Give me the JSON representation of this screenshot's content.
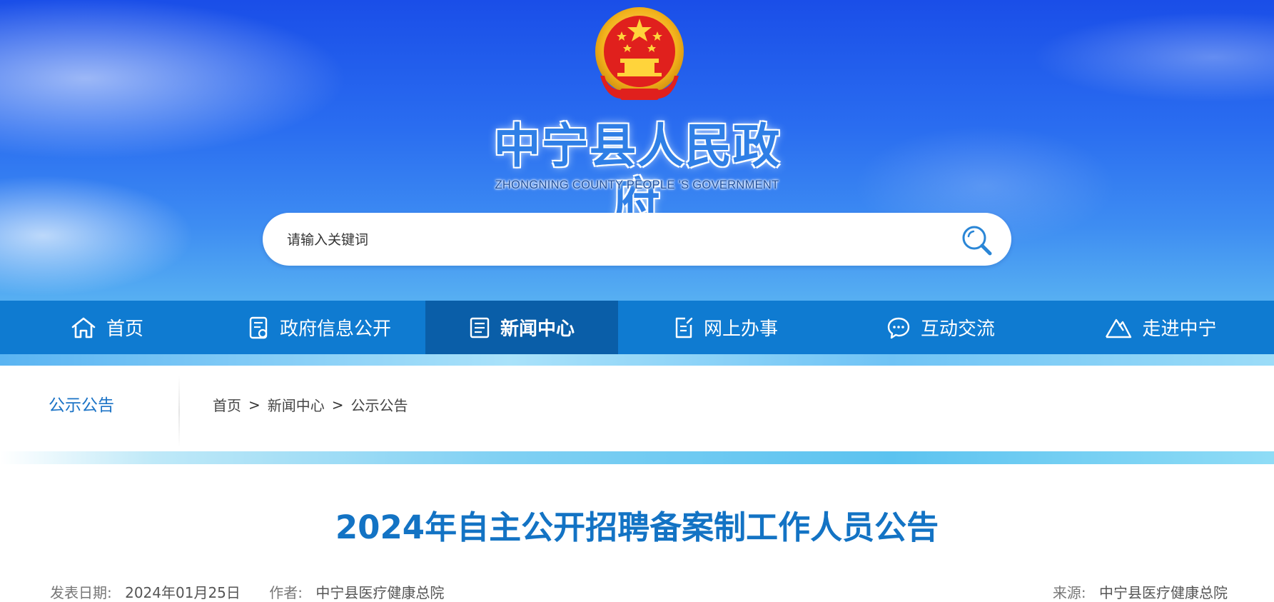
{
  "header": {
    "title": "中宁县人民政府",
    "subtitle": "ZHONGNING COUNTY PEOPLE 'S GOVERNMENT"
  },
  "search": {
    "placeholder": "请输入关键词"
  },
  "nav": {
    "items": [
      {
        "label": "首页",
        "icon": "home-icon"
      },
      {
        "label": "政府信息公开",
        "icon": "document-icon"
      },
      {
        "label": "新闻中心",
        "icon": "news-icon",
        "active": true
      },
      {
        "label": "网上办事",
        "icon": "form-icon"
      },
      {
        "label": "互动交流",
        "icon": "chat-icon"
      },
      {
        "label": "走进中宁",
        "icon": "mountain-icon"
      }
    ]
  },
  "breadcrumb": {
    "section": "公示公告",
    "items": [
      "首页",
      "新闻中心",
      "公示公告"
    ],
    "separator": ">"
  },
  "article": {
    "title": "2024年自主公开招聘备案制工作人员公告",
    "date_label": "发表日期:",
    "date": "2024年01月25日",
    "author_label": "作者:",
    "author": "中宁县医疗健康总院",
    "source_label": "来源:",
    "source": "中宁县医疗健康总院"
  },
  "colors": {
    "nav_bg": "#0f7bd1",
    "nav_active_bg": "#0a5ea8",
    "accent": "#1373c4"
  }
}
